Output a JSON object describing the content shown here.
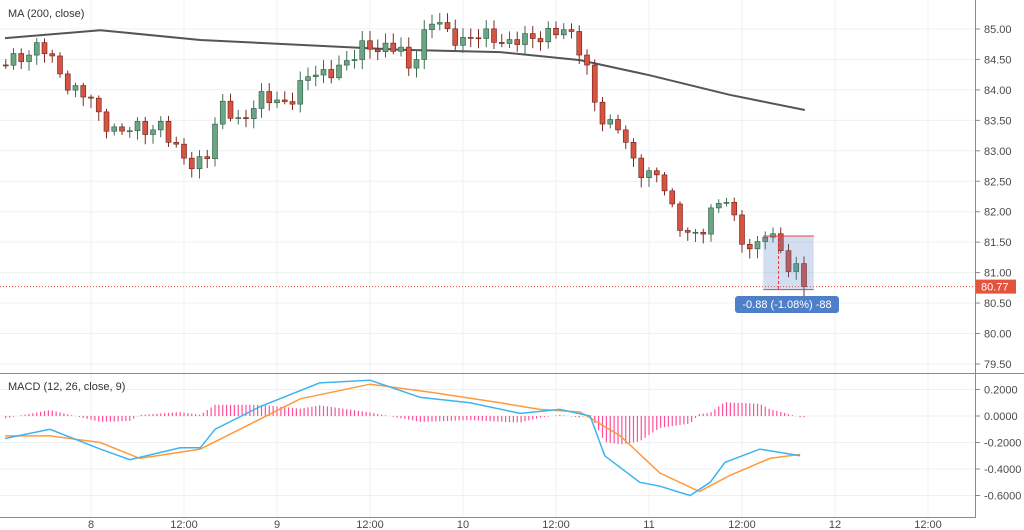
{
  "legends": {
    "price": "MA (200, close)",
    "macd": "MACD (12, 26, close, 9)"
  },
  "colors": {
    "up": "#6ba583",
    "down": "#d75442",
    "ma": "#555555",
    "macd": "#3cb4f0",
    "signal": "#ff9a3c",
    "hist": "#ff4f9a",
    "last": "#e5533d",
    "measure": "#4f7fc9"
  },
  "chart_data": {
    "type": "candlestick",
    "x_unit": "hours since day 8 00:00",
    "x_range": [
      -11.7,
      114
    ],
    "x_ticks": [
      {
        "t": 0,
        "label": "8"
      },
      {
        "t": 12,
        "label": "12:00"
      },
      {
        "t": 24,
        "label": "9"
      },
      {
        "t": 36,
        "label": "12:00"
      },
      {
        "t": 48,
        "label": "10"
      },
      {
        "t": 60,
        "label": "12:00"
      },
      {
        "t": 72,
        "label": "11"
      },
      {
        "t": 84,
        "label": "12:00"
      },
      {
        "t": 96,
        "label": "12"
      },
      {
        "t": 108,
        "label": "12:00"
      }
    ],
    "price_ticks": [
      "85.00",
      "84.50",
      "84.00",
      "83.50",
      "83.00",
      "82.50",
      "82.00",
      "81.50",
      "81.00",
      "80.50",
      "80.00",
      "79.50"
    ],
    "price_range": [
      79.3,
      85.5
    ],
    "last_price": "80.77",
    "price_path": [
      [
        -11.1,
        84.41
      ],
      [
        -6.6,
        84.74
      ],
      [
        -3.4,
        84.16
      ],
      [
        -0.1,
        83.83
      ],
      [
        1.2,
        83.5
      ],
      [
        3.7,
        83.34
      ],
      [
        7.6,
        83.34
      ],
      [
        8.9,
        83.5
      ],
      [
        10.8,
        83.0
      ],
      [
        12.8,
        82.77
      ],
      [
        15.4,
        83.0
      ],
      [
        16.6,
        83.75
      ],
      [
        19.2,
        83.5
      ],
      [
        21.8,
        83.83
      ],
      [
        25.7,
        83.83
      ],
      [
        28.3,
        84.24
      ],
      [
        30.8,
        84.33
      ],
      [
        33.4,
        84.41
      ],
      [
        35.4,
        84.82
      ],
      [
        37.3,
        84.66
      ],
      [
        39.9,
        84.66
      ],
      [
        41.2,
        84.33
      ],
      [
        42.5,
        84.82
      ],
      [
        44.4,
        85.15
      ],
      [
        46.3,
        84.9
      ],
      [
        48.9,
        84.82
      ],
      [
        51.5,
        84.9
      ],
      [
        54.1,
        84.77
      ],
      [
        56.6,
        84.82
      ],
      [
        59.2,
        84.98
      ],
      [
        61.8,
        84.9
      ],
      [
        63.7,
        84.57
      ],
      [
        65.0,
        83.83
      ],
      [
        66.3,
        83.34
      ],
      [
        68.3,
        83.42
      ],
      [
        69.5,
        83.0
      ],
      [
        71.5,
        82.52
      ],
      [
        73.4,
        82.6
      ],
      [
        74.7,
        82.19
      ],
      [
        76.6,
        81.62
      ],
      [
        78.5,
        81.54
      ],
      [
        80.5,
        82.19
      ],
      [
        81.8,
        82.27
      ],
      [
        83.7,
        81.54
      ],
      [
        85.0,
        81.37
      ],
      [
        87.0,
        81.7
      ],
      [
        88.9,
        81.37
      ],
      [
        90.2,
        80.96
      ],
      [
        91.5,
        81.2
      ],
      [
        92.5,
        80.77
      ]
    ],
    "ma200": [
      [
        -11.1,
        84.85
      ],
      [
        1.2,
        84.98
      ],
      [
        14.1,
        84.82
      ],
      [
        39.9,
        84.66
      ],
      [
        52.8,
        84.62
      ],
      [
        63.1,
        84.49
      ],
      [
        72.1,
        84.24
      ],
      [
        82.4,
        83.92
      ],
      [
        92.1,
        83.67
      ]
    ],
    "macd_ticks": [
      "0.2000",
      "0.0000",
      "-0.2000",
      "-0.4000",
      "-0.6000"
    ],
    "macd_range": [
      -0.68,
      0.32
    ],
    "macd": [
      [
        -11.1,
        -0.17
      ],
      [
        -5.3,
        -0.1
      ],
      [
        1.2,
        -0.25
      ],
      [
        5.0,
        -0.33
      ],
      [
        11.5,
        -0.24
      ],
      [
        14.1,
        -0.24
      ],
      [
        16.0,
        -0.1
      ],
      [
        21.8,
        0.07
      ],
      [
        29.5,
        0.25
      ],
      [
        36.0,
        0.27
      ],
      [
        42.5,
        0.14
      ],
      [
        48.9,
        0.1
      ],
      [
        55.4,
        0.02
      ],
      [
        60.5,
        0.05
      ],
      [
        64.4,
        0.0
      ],
      [
        66.3,
        -0.3
      ],
      [
        70.8,
        -0.5
      ],
      [
        73.4,
        -0.53
      ],
      [
        77.3,
        -0.6
      ],
      [
        79.9,
        -0.5
      ],
      [
        81.8,
        -0.35
      ],
      [
        86.3,
        -0.25
      ],
      [
        91.5,
        -0.3
      ]
    ],
    "signal": [
      [
        -11.1,
        -0.15
      ],
      [
        -5.3,
        -0.15
      ],
      [
        1.2,
        -0.2
      ],
      [
        6.3,
        -0.32
      ],
      [
        14.1,
        -0.25
      ],
      [
        19.2,
        -0.1
      ],
      [
        27.0,
        0.13
      ],
      [
        36.0,
        0.24
      ],
      [
        43.7,
        0.18
      ],
      [
        52.8,
        0.1
      ],
      [
        57.9,
        0.05
      ],
      [
        63.1,
        0.03
      ],
      [
        68.3,
        -0.15
      ],
      [
        73.4,
        -0.43
      ],
      [
        78.5,
        -0.57
      ],
      [
        82.4,
        -0.45
      ],
      [
        87.6,
        -0.32
      ],
      [
        91.5,
        -0.29
      ]
    ]
  },
  "measure": {
    "from_t": 87,
    "to_t": 93,
    "from_price": 81.6,
    "to_price": 80.72,
    "label": "-0.88 (-1.08%) -88"
  }
}
